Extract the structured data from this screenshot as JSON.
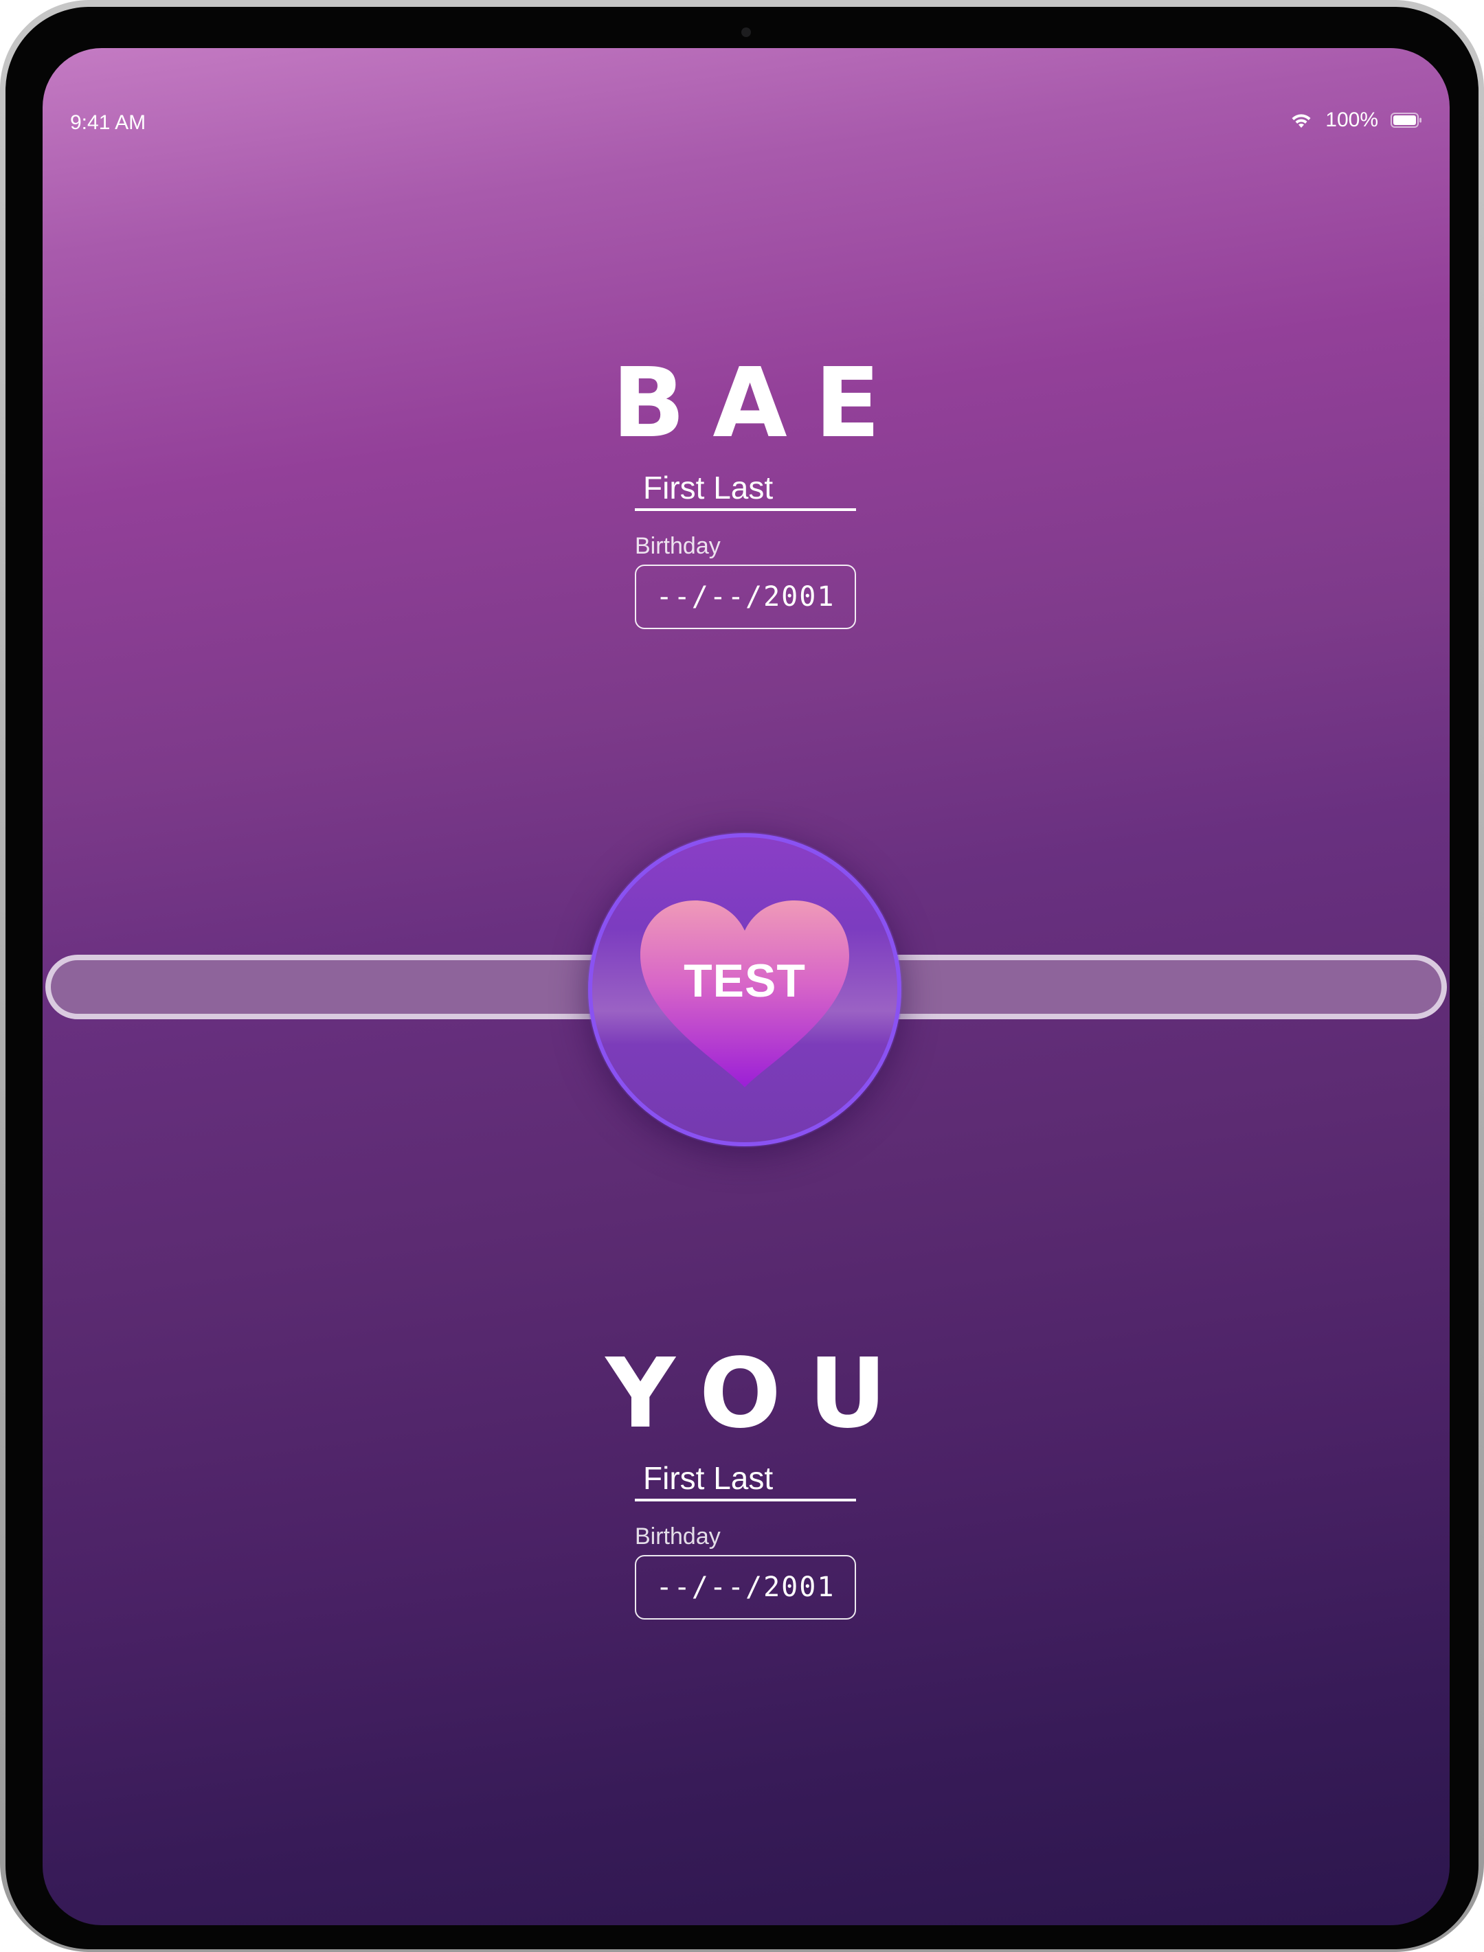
{
  "status_bar": {
    "time": "9:41 AM",
    "battery": "100%",
    "icons": [
      "wifi-icon",
      "battery-icon"
    ]
  },
  "bae": {
    "title": "BAE",
    "name_value": "First Last",
    "birthday_label": "Birthday",
    "birthday_value": "--/--/2001"
  },
  "you": {
    "title": "YOU",
    "name_value": "First Last",
    "birthday_label": "Birthday",
    "birthday_value": "--/--/2001"
  },
  "test_button": {
    "label": "TEST",
    "icon": "heart-icon"
  },
  "colors": {
    "background_top": "#c47bc3",
    "background_bottom": "#2c164d",
    "accent_ring": "#8a52f2",
    "heart_top": "#ef9ab8",
    "heart_bottom": "#9b1fd6",
    "track_fill": "#8e649b",
    "track_border": "#dacbe0"
  }
}
